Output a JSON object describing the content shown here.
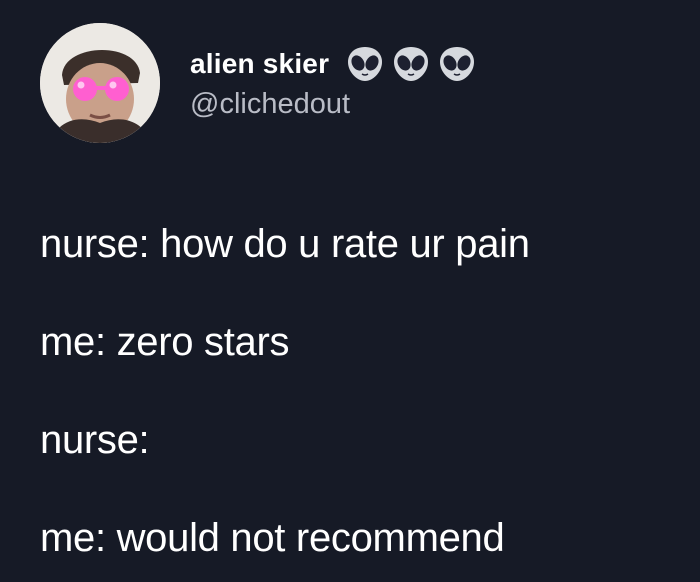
{
  "author": {
    "display_name": "alien skier",
    "handle": "@clichedout",
    "emojis": [
      "alien-icon",
      "alien-icon",
      "alien-icon"
    ]
  },
  "tweet": {
    "lines": [
      "nurse: how do u rate ur pain",
      "me: zero stars",
      "nurse:",
      "me: would not recommend"
    ]
  },
  "colors": {
    "background": "#161a26",
    "text": "#ffffff",
    "handle": "#b9bcc6"
  }
}
